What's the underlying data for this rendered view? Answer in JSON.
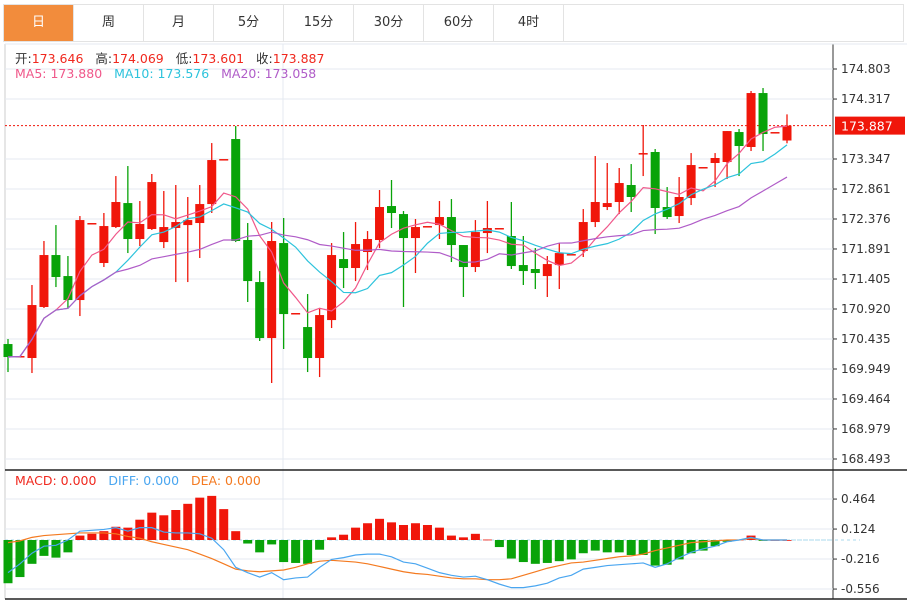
{
  "tabs": [
    {
      "label": "日",
      "active": true
    },
    {
      "label": "周",
      "active": false
    },
    {
      "label": "月",
      "active": false
    },
    {
      "label": "5分",
      "active": false
    },
    {
      "label": "15分",
      "active": false
    },
    {
      "label": "30分",
      "active": false
    },
    {
      "label": "60分",
      "active": false
    },
    {
      "label": "4时",
      "active": false
    }
  ],
  "ohlc_legend": {
    "open_label": "开:",
    "open": "173.646",
    "high_label": "高:",
    "high": "174.069",
    "low_label": "低:",
    "low": "173.601",
    "close_label": "收:",
    "close": "173.887"
  },
  "ma_legend": {
    "ma5": "MA5: 173.880",
    "ma10": "MA10: 173.576",
    "ma20": "MA20: 173.058"
  },
  "macd_legend": {
    "macd": "MACD: 0.000",
    "diff": "DIFF: 0.000",
    "dea": "DEA: 0.000"
  },
  "colors": {
    "up": "#f0160a",
    "down": "#09a309",
    "tab_active": "#f28c3c",
    "ma5": "#f0588a",
    "ma10": "#2dc3dc",
    "ma20": "#b05cc8",
    "diff": "#4aa6f0",
    "dea": "#f47a20"
  },
  "chart_data": [
    {
      "type": "candlestick",
      "title": "",
      "last_price": "173.887",
      "ylim": [
        168.493,
        174.803
      ],
      "y_ticks": [
        "174.803",
        "174.317",
        "173.347",
        "172.861",
        "172.376",
        "171.891",
        "171.405",
        "170.920",
        "170.435",
        "169.949",
        "169.464",
        "168.979",
        "168.493"
      ],
      "y_tick_values": [
        174.803,
        174.317,
        173.347,
        172.861,
        172.376,
        171.891,
        171.405,
        170.92,
        170.435,
        169.949,
        169.464,
        168.979,
        168.493
      ],
      "ohlc": [
        [
          170.353,
          170.434,
          169.9,
          170.143
        ],
        [
          170.159,
          170.159,
          170.159,
          170.159
        ],
        [
          170.127,
          171.308,
          169.884,
          170.984
        ],
        [
          170.952,
          172.02,
          170.936,
          171.793
        ],
        [
          171.793,
          172.278,
          171.275,
          171.437
        ],
        [
          171.453,
          171.777,
          170.936,
          171.065
        ],
        [
          171.065,
          172.424,
          170.806,
          172.359
        ],
        [
          172.311,
          172.311,
          172.311,
          172.311
        ],
        [
          171.664,
          172.473,
          171.599,
          172.262
        ],
        [
          172.246,
          173.071,
          172.23,
          172.651
        ],
        [
          172.634,
          173.233,
          171.825,
          172.052
        ],
        [
          172.052,
          172.667,
          171.939,
          172.295
        ],
        [
          172.214,
          173.104,
          172.198,
          172.974
        ],
        [
          172.003,
          172.829,
          171.906,
          172.246
        ],
        [
          172.23,
          172.926,
          171.356,
          172.327
        ],
        [
          172.278,
          172.732,
          171.356,
          172.359
        ],
        [
          172.311,
          172.926,
          171.745,
          172.618
        ],
        [
          172.618,
          173.605,
          172.473,
          173.33
        ],
        [
          173.346,
          173.346,
          173.346,
          173.346
        ],
        [
          173.67,
          173.88,
          172.003,
          172.02
        ],
        [
          172.036,
          172.311,
          171.033,
          171.372
        ],
        [
          171.356,
          171.534,
          170.402,
          170.45
        ],
        [
          170.45,
          172.327,
          169.722,
          172.02
        ],
        [
          171.987,
          172.392,
          170.272,
          170.838
        ],
        [
          170.855,
          170.855,
          170.855,
          170.855
        ],
        [
          170.628,
          171.162,
          169.9,
          170.127
        ],
        [
          170.127,
          170.936,
          169.819,
          170.822
        ],
        [
          170.741,
          171.987,
          170.612,
          171.793
        ],
        [
          171.728,
          172.165,
          171.259,
          171.583
        ],
        [
          171.583,
          172.327,
          171.372,
          171.971
        ],
        [
          171.842,
          172.181,
          171.55,
          172.052
        ],
        [
          172.036,
          172.845,
          171.906,
          172.57
        ],
        [
          172.586,
          173.007,
          172.23,
          172.473
        ],
        [
          172.456,
          172.505,
          170.952,
          172.068
        ],
        [
          172.068,
          172.376,
          171.502,
          172.246
        ],
        [
          172.262,
          172.262,
          172.262,
          172.262
        ],
        [
          172.278,
          172.667,
          172.052,
          172.408
        ],
        [
          172.408,
          172.699,
          171.68,
          171.955
        ],
        [
          171.955,
          171.955,
          171.114,
          171.599
        ],
        [
          171.599,
          172.359,
          171.518,
          172.165
        ],
        [
          172.149,
          172.667,
          171.825,
          172.23
        ],
        [
          172.23,
          172.23,
          172.23,
          172.23
        ],
        [
          172.101,
          172.651,
          171.567,
          171.615
        ],
        [
          171.631,
          172.101,
          171.308,
          171.534
        ],
        [
          171.567,
          171.906,
          171.243,
          171.502
        ],
        [
          171.453,
          171.777,
          171.114,
          171.647
        ],
        [
          171.631,
          171.987,
          171.243,
          171.825
        ],
        [
          171.809,
          171.809,
          171.809,
          171.809
        ],
        [
          171.858,
          172.537,
          171.761,
          172.327
        ],
        [
          172.327,
          173.395,
          172.246,
          172.651
        ],
        [
          172.57,
          173.282,
          172.521,
          172.634
        ],
        [
          172.651,
          173.201,
          172.456,
          172.958
        ],
        [
          172.926,
          173.265,
          172.489,
          172.732
        ],
        [
          173.443,
          173.897,
          173.071,
          173.443
        ],
        [
          173.46,
          173.508,
          172.133,
          172.554
        ],
        [
          172.57,
          172.893,
          172.376,
          172.408
        ],
        [
          172.424,
          173.055,
          172.311,
          172.732
        ],
        [
          172.715,
          173.443,
          172.602,
          173.249
        ],
        [
          173.217,
          173.217,
          173.217,
          173.217
        ],
        [
          173.282,
          173.443,
          172.893,
          173.363
        ],
        [
          173.298,
          173.799,
          173.023,
          173.799
        ],
        [
          173.783,
          173.832,
          173.071,
          173.557
        ],
        [
          173.541,
          174.447,
          173.476,
          174.414
        ],
        [
          174.414,
          174.495,
          173.476,
          173.751
        ],
        [
          173.783,
          173.783,
          173.783,
          173.783
        ],
        [
          173.646,
          174.069,
          173.601,
          173.887
        ]
      ]
    },
    {
      "type": "bar+line",
      "title": "MACD",
      "ylim": [
        -0.6,
        0.6
      ],
      "y_ticks": [
        "0.464",
        "0.124",
        "-0.216",
        "-0.556"
      ],
      "y_tick_values": [
        0.464,
        0.124,
        -0.216,
        -0.556
      ],
      "macd": [
        -0.49,
        -0.42,
        -0.27,
        -0.18,
        -0.2,
        -0.14,
        0.05,
        0.07,
        0.1,
        0.15,
        0.14,
        0.23,
        0.31,
        0.28,
        0.34,
        0.41,
        0.48,
        0.5,
        0.35,
        0.1,
        -0.04,
        -0.14,
        -0.05,
        -0.25,
        -0.26,
        -0.27,
        -0.11,
        0.03,
        0.06,
        0.14,
        0.19,
        0.24,
        0.2,
        0.17,
        0.19,
        0.17,
        0.14,
        0.05,
        0.03,
        0.07,
        0.005,
        -0.08,
        -0.21,
        -0.25,
        -0.27,
        -0.26,
        -0.24,
        -0.22,
        -0.15,
        -0.12,
        -0.14,
        -0.14,
        -0.17,
        -0.17,
        -0.29,
        -0.28,
        -0.22,
        -0.15,
        -0.12,
        -0.07,
        -0.02,
        0.005,
        0.05,
        -0.01,
        0.0,
        0.0
      ],
      "diff": [
        -0.37,
        -0.27,
        -0.15,
        -0.07,
        -0.06,
        0.0,
        0.1,
        0.11,
        0.12,
        0.14,
        0.1,
        0.14,
        0.14,
        0.09,
        0.08,
        0.08,
        0.07,
        0.02,
        -0.11,
        -0.31,
        -0.37,
        -0.42,
        -0.37,
        -0.45,
        -0.43,
        -0.42,
        -0.31,
        -0.22,
        -0.2,
        -0.17,
        -0.16,
        -0.16,
        -0.19,
        -0.25,
        -0.27,
        -0.32,
        -0.37,
        -0.4,
        -0.42,
        -0.41,
        -0.45,
        -0.5,
        -0.54,
        -0.54,
        -0.52,
        -0.49,
        -0.43,
        -0.4,
        -0.33,
        -0.31,
        -0.29,
        -0.28,
        -0.27,
        -0.26,
        -0.31,
        -0.27,
        -0.2,
        -0.14,
        -0.1,
        -0.07,
        -0.02,
        0.0,
        0.03,
        0.0,
        0.0,
        0.0
      ],
      "dea": [
        -0.03,
        -0.01,
        0.03,
        0.05,
        0.06,
        0.07,
        0.08,
        0.08,
        0.08,
        0.07,
        0.04,
        0.02,
        -0.02,
        -0.05,
        -0.08,
        -0.11,
        -0.16,
        -0.21,
        -0.27,
        -0.33,
        -0.35,
        -0.36,
        -0.35,
        -0.34,
        -0.31,
        -0.27,
        -0.24,
        -0.23,
        -0.24,
        -0.25,
        -0.27,
        -0.3,
        -0.33,
        -0.36,
        -0.38,
        -0.39,
        -0.41,
        -0.43,
        -0.44,
        -0.44,
        -0.45,
        -0.45,
        -0.44,
        -0.4,
        -0.36,
        -0.32,
        -0.29,
        -0.26,
        -0.25,
        -0.23,
        -0.21,
        -0.19,
        -0.18,
        -0.16,
        -0.12,
        -0.09,
        -0.06,
        -0.03,
        -0.02,
        -0.01,
        0.0,
        0.0,
        0.02,
        0.0,
        0.0,
        0.0
      ]
    }
  ]
}
